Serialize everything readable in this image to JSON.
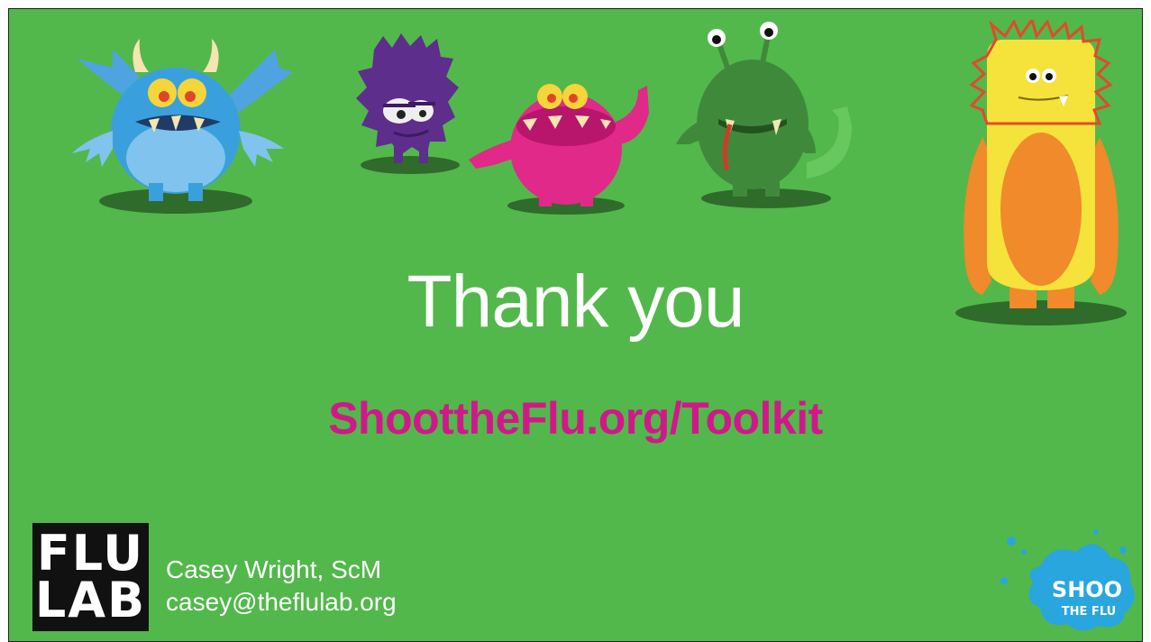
{
  "slide": {
    "title": "Thank you",
    "link": "ShoottheFlu.org/Toolkit",
    "presenter": {
      "name": "Casey Wright, ScM",
      "email": "casey@theflulab.org"
    },
    "logo_left": {
      "line1": "FLU",
      "line2": "LAB"
    },
    "logo_right": {
      "line1": "SHOO",
      "line2": "THE FLU"
    },
    "colors": {
      "background": "#52b84b",
      "title": "#ffffff",
      "link": "#d1188b"
    },
    "monsters": [
      "blue-winged-monster",
      "purple-fuzzy-monster",
      "pink-waving-monster",
      "green-antenna-monster",
      "yellow-spiky-monster"
    ]
  }
}
